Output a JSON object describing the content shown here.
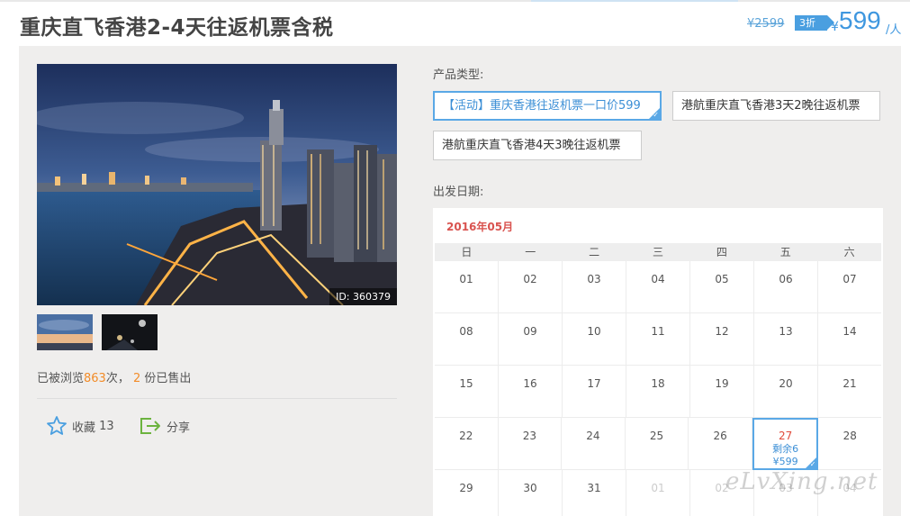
{
  "product": {
    "title": "重庆直飞香港2-4天往返机票含税",
    "original_price": "¥2599",
    "discount": "3折",
    "price_symbol": "¥",
    "price": "599",
    "price_unit": "/人"
  },
  "gallery": {
    "image_id": "ID: 360379",
    "thumbnails": [
      "sunset-skyline",
      "disneyland-night"
    ]
  },
  "stats": {
    "views_prefix": "已被浏览",
    "views": "863",
    "views_suffix": "次，",
    "sold": "2",
    "sold_suffix": "份已售出"
  },
  "actions": {
    "favorite_label": "收藏",
    "favorite_count": "13",
    "share_label": "分享"
  },
  "product_type": {
    "label": "产品类型:",
    "options": [
      "【活动】重庆香港往返机票一口价599",
      "港航重庆直飞香港3天2晚往返机票",
      "港航重庆直飞香港4天3晚往返机票"
    ],
    "selected_index": 0
  },
  "departure": {
    "label": "出发日期:"
  },
  "calendar": {
    "month": "2016年05月",
    "weekdays": [
      "日",
      "一",
      "二",
      "三",
      "四",
      "五",
      "六"
    ],
    "weeks": [
      [
        "01",
        "02",
        "03",
        "04",
        "05",
        "06",
        "07"
      ],
      [
        "08",
        "09",
        "10",
        "11",
        "12",
        "13",
        "14"
      ],
      [
        "15",
        "16",
        "17",
        "18",
        "19",
        "20",
        "21"
      ],
      [
        "22",
        "23",
        "24",
        "25",
        "26",
        "27",
        "28"
      ],
      [
        "29",
        "30",
        "31",
        "01",
        "02",
        "03",
        "04"
      ]
    ],
    "selected": {
      "week": 3,
      "day": 5,
      "remain": "剩余6",
      "price": "¥599"
    }
  },
  "watermark": "eLvXing.net",
  "colors": {
    "accent_blue": "#3f97df",
    "highlight_orange": "#f28c28",
    "month_red": "#d9534f",
    "panel_bg": "#efeeed"
  }
}
